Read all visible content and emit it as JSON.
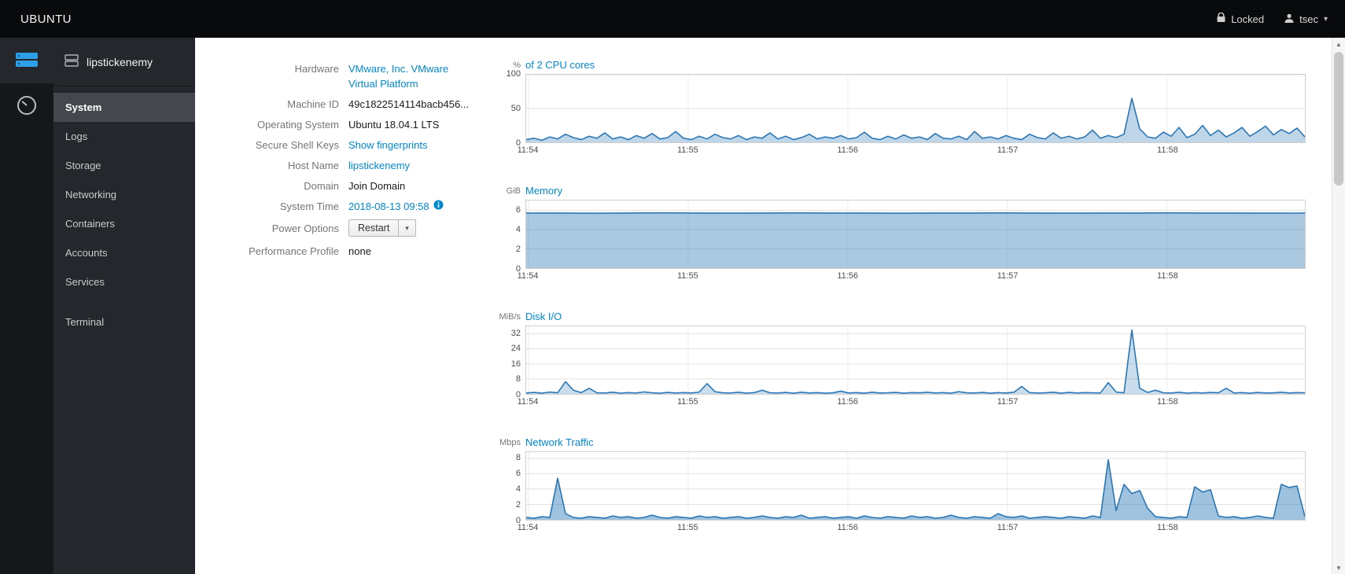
{
  "topbar": {
    "brand": "UBUNTU",
    "locked_label": "Locked",
    "user": "tsec"
  },
  "glyphs": {
    "caret": "▾",
    "scroll_up": "▲",
    "scroll_down": "▼"
  },
  "sidebar": {
    "host_name": "lipstickenemy",
    "items": [
      {
        "label": "System"
      },
      {
        "label": "Logs"
      },
      {
        "label": "Storage"
      },
      {
        "label": "Networking"
      },
      {
        "label": "Containers"
      },
      {
        "label": "Accounts"
      },
      {
        "label": "Services"
      },
      {
        "label": "Terminal"
      }
    ]
  },
  "system": {
    "rows": [
      {
        "label": "Hardware",
        "value": "VMware, Inc. VMware Virtual Platform"
      },
      {
        "label": "Machine ID",
        "value": "49c1822514114bacb456..."
      },
      {
        "label": "Operating System",
        "value": "Ubuntu 18.04.1 LTS"
      },
      {
        "label": "Secure Shell Keys",
        "value": "Show fingerprints"
      },
      {
        "label": "Host Name",
        "value": "lipstickenemy"
      },
      {
        "label": "Domain",
        "value": "Join Domain"
      },
      {
        "label": "System Time",
        "value": "2018-08-13 09:58"
      },
      {
        "label": "Power Options",
        "value": "Restart"
      },
      {
        "label": "Performance Profile",
        "value": "none"
      }
    ]
  },
  "chart_data": [
    {
      "type": "area",
      "unit": "%",
      "title": "of 2 CPU cores",
      "x_labels": [
        "11:54",
        "11:55",
        "11:56",
        "11:57",
        "11:58"
      ],
      "yticks": [
        0,
        50,
        100
      ],
      "ylim": [
        0,
        100
      ],
      "color": "#2b77b5",
      "fill_opacity": 0.3,
      "values": [
        4,
        6,
        3,
        8,
        5,
        12,
        7,
        4,
        9,
        6,
        14,
        5,
        8,
        4,
        10,
        6,
        13,
        5,
        7,
        16,
        6,
        4,
        9,
        5,
        12,
        7,
        5,
        10,
        4,
        8,
        6,
        14,
        5,
        9,
        4,
        7,
        12,
        5,
        8,
        6,
        10,
        5,
        7,
        15,
        6,
        4,
        9,
        5,
        11,
        6,
        8,
        4,
        13,
        6,
        5,
        9,
        4,
        16,
        6,
        8,
        5,
        10,
        6,
        4,
        12,
        7,
        5,
        14,
        6,
        9,
        5,
        8,
        18,
        6,
        10,
        7,
        12,
        65,
        20,
        8,
        6,
        15,
        9,
        22,
        7,
        12,
        25,
        10,
        18,
        8,
        14,
        22,
        9,
        16,
        24,
        11,
        19,
        13,
        21,
        8
      ]
    },
    {
      "type": "area",
      "unit": "GiB",
      "title": "Memory",
      "x_labels": [
        "11:54",
        "11:55",
        "11:56",
        "11:57",
        "11:58"
      ],
      "yticks": [
        0,
        2,
        4,
        6
      ],
      "ylim": [
        0,
        7
      ],
      "color": "#2b77b5",
      "fill_opacity": 0.4,
      "values": [
        5.7,
        5.7,
        5.68,
        5.7,
        5.72,
        5.7,
        5.69,
        5.7,
        5.71,
        5.7,
        5.7,
        5.68,
        5.7,
        5.7,
        5.71,
        5.7,
        5.69,
        5.7,
        5.7,
        5.72,
        5.7,
        5.7,
        5.69,
        5.7
      ]
    },
    {
      "type": "area",
      "unit": "MiB/s",
      "title": "Disk I/O",
      "x_labels": [
        "11:54",
        "11:55",
        "11:56",
        "11:57",
        "11:58"
      ],
      "yticks": [
        0,
        8,
        16,
        24,
        32
      ],
      "ylim": [
        0,
        36
      ],
      "color": "#2b77b5",
      "fill_opacity": 0.25,
      "values": [
        0.5,
        0.8,
        0.4,
        1.0,
        0.6,
        6.5,
        2.0,
        0.7,
        3.0,
        0.6,
        0.5,
        0.9,
        0.4,
        0.7,
        0.5,
        1.1,
        0.6,
        0.4,
        0.8,
        0.5,
        0.7,
        0.5,
        1.0,
        5.5,
        1.2,
        0.6,
        0.5,
        0.9,
        0.4,
        0.7,
        2.0,
        0.6,
        0.5,
        0.8,
        0.4,
        0.9,
        0.5,
        0.7,
        0.4,
        0.6,
        1.5,
        0.5,
        0.7,
        0.4,
        0.9,
        0.5,
        0.6,
        0.8,
        0.4,
        0.7,
        0.6,
        0.9,
        0.5,
        0.7,
        0.4,
        1.2,
        0.6,
        0.5,
        0.8,
        0.4,
        0.7,
        0.5,
        0.9,
        4.0,
        0.7,
        0.5,
        0.6,
        0.9,
        0.4,
        0.8,
        0.5,
        0.7,
        0.6,
        0.5,
        6.0,
        1.0,
        0.6,
        34,
        3.0,
        0.8,
        2.0,
        0.6,
        0.5,
        0.9,
        0.4,
        0.7,
        0.5,
        0.8,
        0.6,
        3.0,
        0.5,
        0.7,
        0.4,
        0.8,
        0.5,
        0.6,
        0.9,
        0.5,
        0.7,
        0.6
      ]
    },
    {
      "type": "area",
      "unit": "Mbps",
      "title": "Network Traffic",
      "x_labels": [
        "11:54",
        "11:55",
        "11:56",
        "11:57",
        "11:58"
      ],
      "yticks": [
        0,
        2,
        4,
        6,
        8
      ],
      "ylim": [
        0,
        8.8
      ],
      "color": "#2b77b5",
      "fill_opacity": 0.45,
      "values": [
        0.3,
        0.2,
        0.4,
        0.3,
        5.4,
        0.8,
        0.3,
        0.2,
        0.4,
        0.3,
        0.2,
        0.5,
        0.3,
        0.4,
        0.2,
        0.3,
        0.6,
        0.3,
        0.2,
        0.4,
        0.3,
        0.2,
        0.5,
        0.3,
        0.4,
        0.2,
        0.3,
        0.4,
        0.2,
        0.3,
        0.5,
        0.3,
        0.2,
        0.4,
        0.3,
        0.6,
        0.2,
        0.3,
        0.4,
        0.2,
        0.3,
        0.4,
        0.2,
        0.5,
        0.3,
        0.2,
        0.4,
        0.3,
        0.2,
        0.5,
        0.3,
        0.4,
        0.2,
        0.3,
        0.6,
        0.3,
        0.2,
        0.4,
        0.3,
        0.2,
        0.8,
        0.4,
        0.3,
        0.5,
        0.2,
        0.3,
        0.4,
        0.3,
        0.2,
        0.4,
        0.3,
        0.2,
        0.5,
        0.3,
        7.8,
        1.2,
        4.6,
        3.4,
        3.8,
        1.5,
        0.4,
        0.3,
        0.2,
        0.4,
        0.3,
        4.3,
        3.6,
        3.9,
        0.5,
        0.3,
        0.4,
        0.2,
        0.3,
        0.5,
        0.3,
        0.2,
        4.6,
        4.2,
        4.4,
        0.4
      ]
    }
  ]
}
